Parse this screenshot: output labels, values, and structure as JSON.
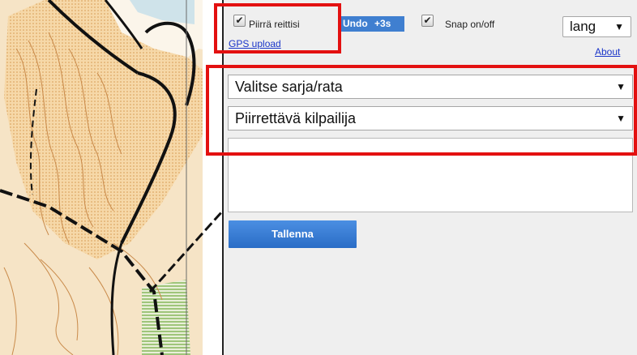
{
  "toolbar": {
    "draw_route_label": "Piirrä reittisi",
    "undo_label": "Undo",
    "plus3s_label": "+3s",
    "snap_label": "Snap on/off",
    "gps_upload_label": "GPS upload",
    "about_label": "About",
    "lang_label": "lang",
    "checkmark": "✔"
  },
  "form": {
    "series_select": "Valitse sarja/rata",
    "competitor_select": "Piirrettävä kilpailija",
    "dropdown_glyph": "▼",
    "save_label": "Tallenna"
  },
  "colors": {
    "accent_blue": "#3f7fd0",
    "highlight_red": "#e31010",
    "map_yellow": "#f4c98d",
    "map_contour": "#c98a4a",
    "map_green": "#9fc57a"
  }
}
